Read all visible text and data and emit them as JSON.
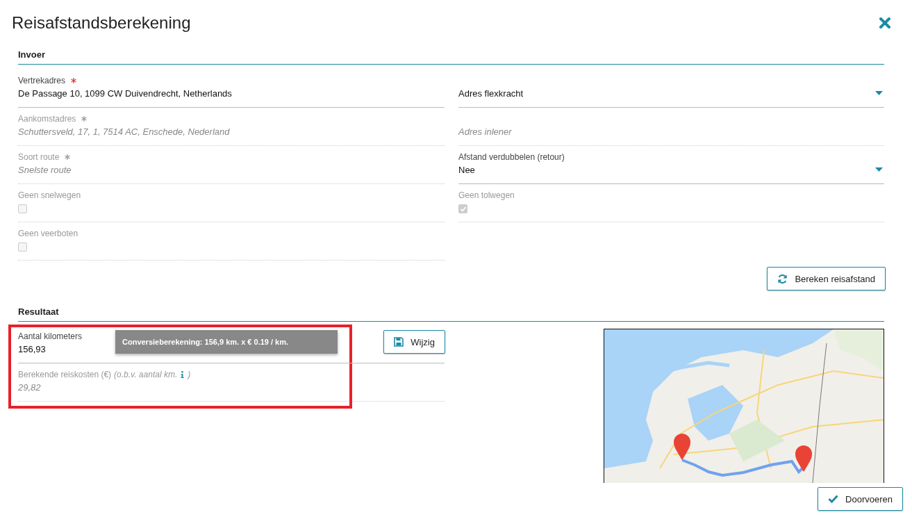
{
  "dialog": {
    "title": "Reisafstandsberekening"
  },
  "input_section": {
    "heading": "Invoer",
    "rows": [
      [
        {
          "kind": "text",
          "label": "Vertrekadres",
          "required": true,
          "disabled": false,
          "value": "De Passage 10, 1099 CW Duivendrecht, Netherlands"
        },
        {
          "kind": "select",
          "disabled": false,
          "value": "Adres flexkracht"
        }
      ],
      [
        {
          "kind": "text",
          "label": "Aankomstadres",
          "required": true,
          "disabled": true,
          "value": "Schuttersveld, 17, 1, 7514 AC, Enschede, Nederland"
        },
        {
          "kind": "text",
          "disabled": true,
          "placeholder": "Adres inlener"
        }
      ],
      [
        {
          "kind": "text",
          "label": "Soort route",
          "required": true,
          "disabled": true,
          "value": "Snelste route"
        },
        {
          "kind": "select",
          "label": "Afstand verdubbelen (retour)",
          "required": false,
          "disabled": false,
          "value": "Nee"
        }
      ],
      [
        {
          "kind": "checkbox",
          "label": "Geen snelwegen",
          "disabled": true,
          "checked": false
        },
        {
          "kind": "checkbox",
          "label": "Geen tolwegen",
          "disabled": true,
          "checked": true
        }
      ],
      [
        {
          "kind": "checkbox",
          "label": "Geen veerboten",
          "disabled": true,
          "checked": false
        }
      ]
    ],
    "calculate_button": "Bereken reisafstand"
  },
  "result_section": {
    "heading": "Resultaat",
    "kilometers": {
      "label": "Aantal kilometers",
      "value": "156,93",
      "disabled": false
    },
    "tooltip": "Conversieberekening: 156,9 km. x € 0.19 / km.",
    "edit_button": "Wijzig",
    "costs": {
      "label": "Berekende reiskosten (€)",
      "note_open": "(o.b.v. aantal km.",
      "note_close": ")",
      "value": "29,82",
      "disabled": true
    },
    "highlighted": true
  },
  "confirm_button": "Doorvoeren"
}
